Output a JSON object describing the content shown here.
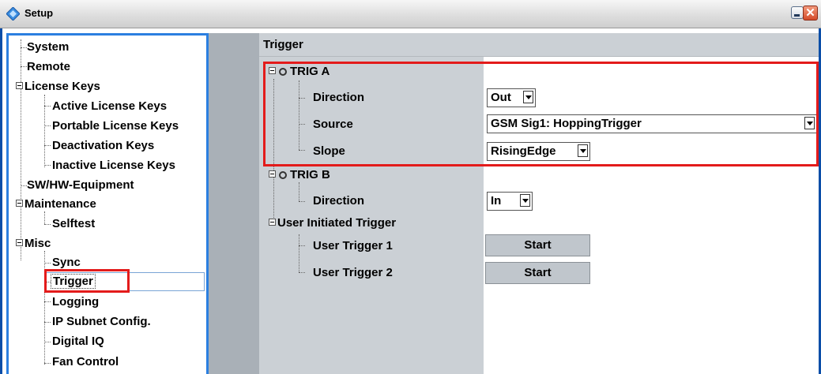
{
  "window": {
    "title": "Setup"
  },
  "sidebar": {
    "items": [
      {
        "label": "System"
      },
      {
        "label": "Remote"
      },
      {
        "label": "License Keys"
      },
      {
        "label": "Active License Keys"
      },
      {
        "label": "Portable License Keys"
      },
      {
        "label": "Deactivation Keys"
      },
      {
        "label": "Inactive License Keys"
      },
      {
        "label": "SW/HW-Equipment"
      },
      {
        "label": "Maintenance"
      },
      {
        "label": "Selftest"
      },
      {
        "label": "Misc"
      },
      {
        "label": "Sync"
      },
      {
        "label": "Trigger"
      },
      {
        "label": "Logging"
      },
      {
        "label": "IP Subnet Config."
      },
      {
        "label": "Digital IQ"
      },
      {
        "label": "Fan Control"
      }
    ],
    "selected": "Trigger"
  },
  "main": {
    "title": "Trigger",
    "trig_a": {
      "label": "TRIG A",
      "direction_label": "Direction",
      "direction_value": "Out",
      "source_label": "Source",
      "source_value": "GSM Sig1: HoppingTrigger",
      "slope_label": "Slope",
      "slope_value": "RisingEdge"
    },
    "trig_b": {
      "label": "TRIG B",
      "direction_label": "Direction",
      "direction_value": "In"
    },
    "user": {
      "label": "User Initiated Trigger",
      "t1_label": "User Trigger 1",
      "t1_button": "Start",
      "t2_label": "User Trigger 2",
      "t2_button": "Start"
    }
  },
  "colors": {
    "highlight": "#e31b1b",
    "title_blue": "#0b4ea8"
  }
}
